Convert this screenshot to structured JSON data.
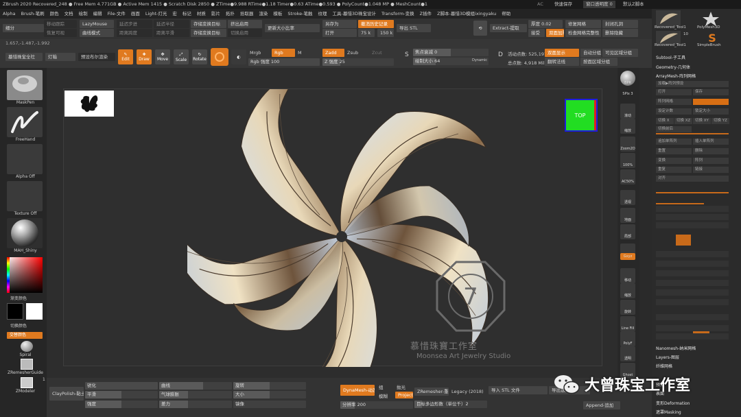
{
  "titlebar": {
    "text": "ZBrush 2020   Recovered_248  ●  Free Mem 4.771GB ● Active Mem 1415 ● Scratch Disk 2850 ● ZTime●9.988 RTime●1.18 Timer●0.63 ATime●0.593 ● PolyCount●1.048 MP ● MeshCount●1",
    "ac": "AC",
    "quicksave": "快速保存",
    "menu_transparency": "窗口透明度 0",
    "default_script": "默认Z脚本"
  },
  "menubar": [
    "Alpha",
    "Brush-笔刷",
    "颜色",
    "文档",
    "绘制",
    "编辑",
    "File-文件",
    "画面",
    "Light-灯光",
    "宏",
    "标记",
    "材质",
    "影片",
    "拓扑",
    "拾取器",
    "渲染",
    "模板",
    "Stroke-笔触",
    "纹理",
    "工具-墓惜3D珠宝设计",
    "Transform-变换",
    "Z插件",
    "Z脚本-墓惜3D模组ixingyaku",
    "帮助"
  ],
  "toolbar1": {
    "item0": "细分",
    "item1": "移动跟踪",
    "item2": "恢复可视",
    "lazymouse": "LazyMouse",
    "curve": "曲线模式",
    "item5": "延迟步进",
    "item6": "距离跨度",
    "item7": "延迟半径",
    "item8": "距离平滑",
    "proj": "存储变换目标",
    "proj2": "存储变换目标",
    "proj3": "挤出启用",
    "proj4": "切换启用",
    "size": "更新大小比率",
    "saveas": "另存为",
    "open": "打开",
    "history": "撤消历史记录",
    "v75": "75 k",
    "v150": "150 k",
    "export": "导出 STL",
    "extract": "Extract-提取",
    "thickness": "厚度 0.02",
    "accept": "接受",
    "double": "双面加厚",
    "repair": "修复网格",
    "check": "检查网格完整性",
    "closeholes": "封闭孔洞",
    "delhidden": "删除隐藏"
  },
  "toolbar2": {
    "coords": "1.657,-1.487,-1.992",
    "btn_a": "墓惜珠宝全社",
    "btn_b": "灯箱",
    "btn_c": "预设布尔渲染",
    "edit": "Edit",
    "draw": "Draw",
    "move": "Move",
    "scale": "Scale",
    "rotate": "Rotate",
    "mrgb": "Mrgb",
    "rgb": "Rgb",
    "m": "M",
    "rgb_intensity": "Rgb 强度 100",
    "zadd": "Zadd",
    "zsub": "Zsub",
    "zcut": "Zcut",
    "z_intensity": "Z 强度 25",
    "focal": "焦点衰减 0",
    "drawsize": "绘制大小 64",
    "dynamic": "Dynamic",
    "active_points": "活动点数: 525,197",
    "total_points": "总点数: 4,918 Mil",
    "doubleside": "双面显示",
    "flip": "翻转法线",
    "autogroup": "自动分组",
    "visible_group": "可见区域分组",
    "polish_group": "按面区域分组"
  },
  "leftshelf": {
    "brush_label": "MaskPen",
    "stroke_label": "FreeHand",
    "alpha_label": "Alpha Off",
    "texture_label": "Texture Off",
    "material_label": "MAH_Shiny",
    "main_color": "渐变颜色",
    "switch_color": "切换颜色",
    "alt_color": "交替颜色",
    "spiral": "Spiral",
    "zremesher": "ZRemesherGuide",
    "zmodeler": "ZModeler",
    "zmodeler_count": "1"
  },
  "canvas": {
    "navcube": "TOP",
    "watermark_cn": "慕惜珠寶工作室",
    "watermark_en": "Moonsea Art Jewelry Studio"
  },
  "rightshelf": [
    "BPR",
    "SPix 3",
    "滚动",
    "缩放",
    "Zoom2D",
    "100%",
    "AC50%",
    "透视",
    "地面",
    "局部",
    "对称",
    "Gxyz",
    "移动",
    "缩放",
    "旋转",
    "Line Fill",
    "PolyF",
    "透明",
    "Ghost",
    "Solo",
    "Xpose"
  ],
  "panel": {
    "tools": [
      "Recovered_Tool1",
      "PolyMesh3D",
      "Recovered_Tool1",
      "SimpleBrush"
    ],
    "tool_count": "10",
    "subtool": "Subtool-子工具",
    "geometry": "Geometry-几何体",
    "arraymesh": "ArrayMesh-阵列网格",
    "rows": [
      "加载▶阵列预设",
      "打开",
      "保存",
      "阵列网格",
      "设定计数",
      "锁定大小",
      "切换 X",
      "切换 XZ",
      "切换 XY",
      "切换 YZ",
      "切换前后",
      "追加单阵列",
      "插入单阵列",
      "重置",
      "删除",
      "变换",
      "阵列",
      "重复",
      "链接",
      "对齐"
    ],
    "nanomesh": "Nanomesh-纳米网格",
    "layers": "Layers-图层",
    "fibermesh": "纤维网格",
    "preview": "预览",
    "surface": "表面",
    "deformation": "变形Deformation",
    "masking": "遮罩Masking"
  },
  "bottombar": {
    "brush": "ClayPolish-黏土",
    "sharpen": "锐化",
    "smooth": "平滑",
    "sharp_edges": "锐边",
    "quality": "强度",
    "curve": "曲线",
    "gas": "气球膨胀",
    "force": "差力",
    "rotate": "旋转",
    "size": "大小",
    "mirror": "镜像",
    "dynamesh": "DynaMesh-动态",
    "group": "组",
    "polish": "抛光",
    "blur": "模糊",
    "project": "Project",
    "resolution": "分辨率 200",
    "zremesher": "ZRemesher-重新",
    "legacy": "Legacy (2018)",
    "target": "目标多边形数（单位千）2",
    "import": "导入 STL 文件",
    "export_sel": "导出选定",
    "append": "Append-追加"
  },
  "wechat": {
    "text": "大曾珠宝工作室"
  },
  "colors": {
    "accent": "#e07a1f",
    "background": "#2a2a2a",
    "navcube": "#22dd22"
  }
}
